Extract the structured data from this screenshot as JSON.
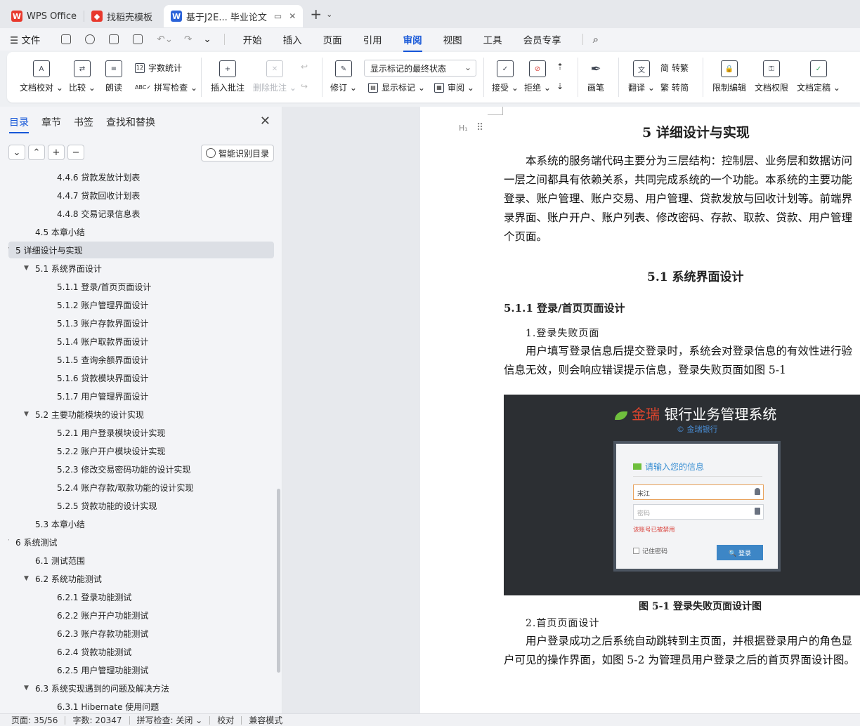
{
  "tabs": [
    {
      "label": "WPS Office",
      "icon": "wps-logo-icon"
    },
    {
      "label": "找稻壳模板",
      "icon": "docer-icon"
    },
    {
      "label": "基于J2E... 毕业论文",
      "icon": "word-doc-icon"
    }
  ],
  "menu": {
    "file": "文件",
    "items": [
      "开始",
      "插入",
      "页面",
      "引用",
      "审阅",
      "视图",
      "工具",
      "会员专享"
    ],
    "active": "审阅"
  },
  "ribbon": {
    "doc_check": "文档校对",
    "compare": "比较",
    "read_aloud": "朗读",
    "word_count": "字数统计",
    "spell_check": "拼写检查",
    "insert_comment": "插入批注",
    "delete_comment": "删除批注",
    "track_changes": "修订",
    "markup_state": "显示标记的最终状态",
    "show_markup": "显示标记",
    "review": "审阅",
    "accept": "接受",
    "reject": "拒绝",
    "pen": "画笔",
    "translate": "翻译",
    "to_traditional": "转繁",
    "to_simplified": "转简",
    "restrict_edit": "限制编辑",
    "doc_permission": "文档权限",
    "finalize": "文档定稿"
  },
  "nav": {
    "tabs": [
      "目录",
      "章节",
      "书签",
      "查找和替换"
    ],
    "smart_toc": "智能识别目录",
    "toc": [
      {
        "text": "4.4.6  贷款发放计划表",
        "level": 3,
        "caret": ""
      },
      {
        "text": "4.4.7  贷款回收计划表",
        "level": 3,
        "caret": ""
      },
      {
        "text": "4.4.8  交易记录信息表",
        "level": 3,
        "caret": ""
      },
      {
        "text": "4.5  本章小结",
        "level": 2,
        "caret": ""
      },
      {
        "text": "5  详细设计与实现",
        "level": 1,
        "caret": "▼",
        "selected": true
      },
      {
        "text": "5.1  系统界面设计",
        "level": 2,
        "caret": "▼"
      },
      {
        "text": "5.1.1  登录/首页页面设计",
        "level": 3,
        "caret": ""
      },
      {
        "text": "5.1.2  账户管理界面设计",
        "level": 3,
        "caret": ""
      },
      {
        "text": "5.1.3  账户存款界面设计",
        "level": 3,
        "caret": ""
      },
      {
        "text": "5.1.4  账户取款界面设计",
        "level": 3,
        "caret": ""
      },
      {
        "text": "5.1.5  查询余额界面设计",
        "level": 3,
        "caret": ""
      },
      {
        "text": "5.1.6  贷款模块界面设计",
        "level": 3,
        "caret": ""
      },
      {
        "text": "5.1.7  用户管理界面设计",
        "level": 3,
        "caret": ""
      },
      {
        "text": "5.2  主要功能模块的设计实现",
        "level": 2,
        "caret": "▼"
      },
      {
        "text": "5.2.1  用户登录模块设计实现",
        "level": 3,
        "caret": ""
      },
      {
        "text": "5.2.2  账户开户模块设计实现",
        "level": 3,
        "caret": ""
      },
      {
        "text": "5.2.3  修改交易密码功能的设计实现",
        "level": 3,
        "caret": ""
      },
      {
        "text": "5.2.4  账户存款/取款功能的设计实现",
        "level": 3,
        "caret": ""
      },
      {
        "text": "5.2.5  贷款功能的设计实现",
        "level": 3,
        "caret": ""
      },
      {
        "text": "5.3  本章小结",
        "level": 2,
        "caret": ""
      },
      {
        "text": "6  系统测试",
        "level": 1,
        "caret": "▼"
      },
      {
        "text": "6.1  测试范围",
        "level": 2,
        "caret": ""
      },
      {
        "text": "6.2  系统功能测试",
        "level": 2,
        "caret": "▼"
      },
      {
        "text": "6.2.1  登录功能测试",
        "level": 3,
        "caret": ""
      },
      {
        "text": "6.2.2  账户开户功能测试",
        "level": 3,
        "caret": ""
      },
      {
        "text": "6.2.3  账户存款功能测试",
        "level": 3,
        "caret": ""
      },
      {
        "text": "6.2.4  贷款功能测试",
        "level": 3,
        "caret": ""
      },
      {
        "text": "6.2.5  用户管理功能测试",
        "level": 3,
        "caret": ""
      },
      {
        "text": "6.3 系统实现遇到的问题及解决方法",
        "level": 2,
        "caret": "▼"
      },
      {
        "text": "6.3.1 Hibernate 使用问题",
        "level": 3,
        "caret": ""
      }
    ]
  },
  "doc": {
    "h1": "5  详细设计与实现",
    "para1": [
      "本系统的服务端代码主要分为三层结构：控制层、业务层和数据访问",
      "一层之间都具有依赖关系，共同完成系统的一个功能。本系统的主要功能",
      "登录、账户管理、账户交易、用户管理、贷款发放与回收计划等。前端界",
      "录界面、账户开户、账户列表、修改密码、存款、取款、贷款、用户管理",
      "个页面。"
    ],
    "h2": "5.1  系统界面设计",
    "h3": "5.1.1  登录/首页页面设计",
    "sub1": "1.登录失败页面",
    "para2": [
      "用户填写登录信息后提交登录时，系统会对登录信息的有效性进行验",
      "信息无效，则会响应错误提示信息，登录失败页面如图 5-1"
    ],
    "figure": {
      "title_brand": "金瑞",
      "title_rest": " 银行业务管理系统",
      "subtitle": "© 金瑞银行",
      "card_title": "请输入您的信息",
      "username_value": "宋江",
      "password_placeholder": "密码",
      "error_text": "该账号已被禁用",
      "remember": "记住密码",
      "login": "🔍 登录"
    },
    "caption": "图 5-1  登录失败页面设计图",
    "sub2": "2.首页页面设计",
    "para3": [
      "用户登录成功之后系统自动跳转到主页面，并根据登录用户的角色显",
      "户可见的操作界面，如图 5-2 为管理员用户登录之后的首页界面设计图。"
    ]
  },
  "status": {
    "page": "页面: 35/56",
    "words": "字数: 20347",
    "spell": "拼写检查: 关闭 ⌄",
    "proof": "校对",
    "compat": "兼容模式"
  }
}
